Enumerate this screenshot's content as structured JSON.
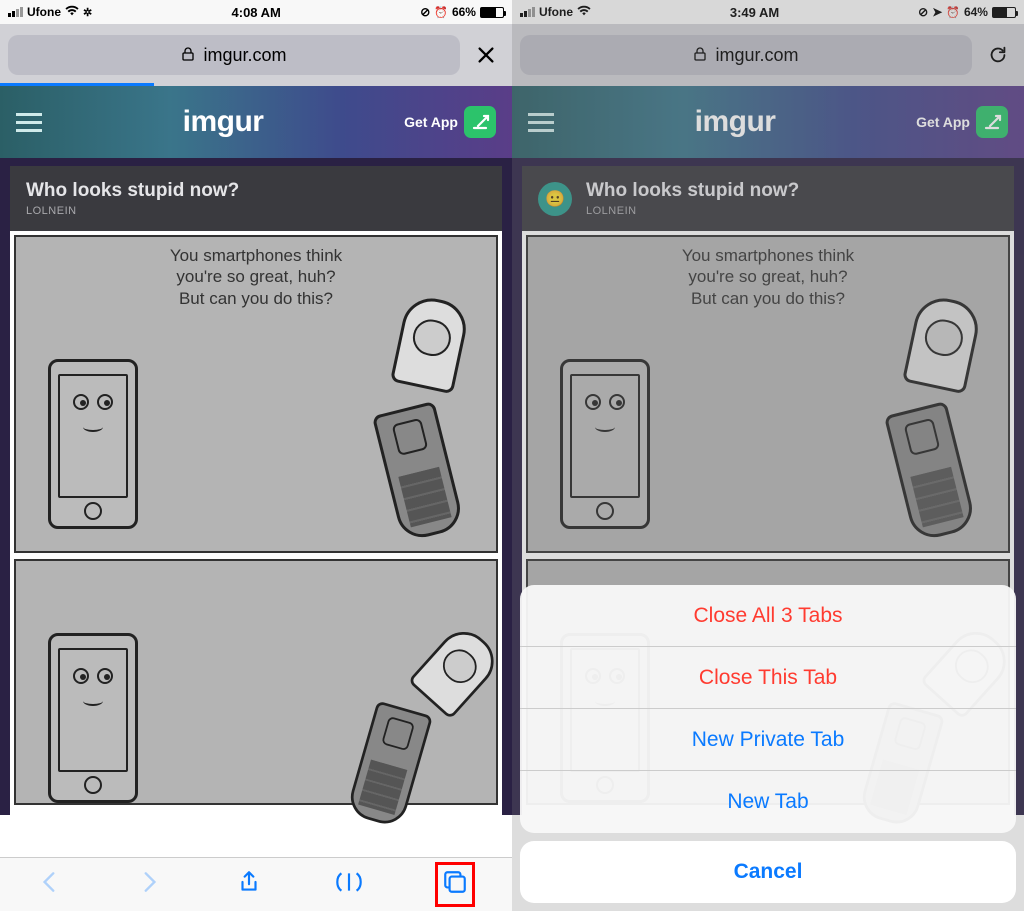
{
  "left": {
    "status": {
      "carrier": "Ufone",
      "time": "4:08 AM",
      "battery": "66%",
      "battery_fill": 66,
      "progress_pct": 30
    },
    "url": "imgur.com",
    "site": {
      "logo": "imgur",
      "get_app": "Get App"
    },
    "post": {
      "title": "Who looks stupid now?",
      "author": "LOLNEIN",
      "comic_text": "You smartphones think\nyou're so great, huh?\nBut can you do this?"
    }
  },
  "right": {
    "status": {
      "carrier": "Ufone",
      "time": "3:49 AM",
      "battery": "64%",
      "battery_fill": 64
    },
    "url": "imgur.com",
    "site": {
      "logo": "imgur",
      "get_app": "Get App"
    },
    "post": {
      "title": "Who looks stupid now?",
      "author": "LOLNEIN",
      "comic_text": "You smartphones think\nyou're so great, huh?\nBut can you do this?"
    },
    "sheet": {
      "close_all": "Close All 3 Tabs",
      "close_this": "Close This Tab",
      "private": "New Private Tab",
      "new_tab": "New Tab",
      "cancel": "Cancel"
    }
  }
}
